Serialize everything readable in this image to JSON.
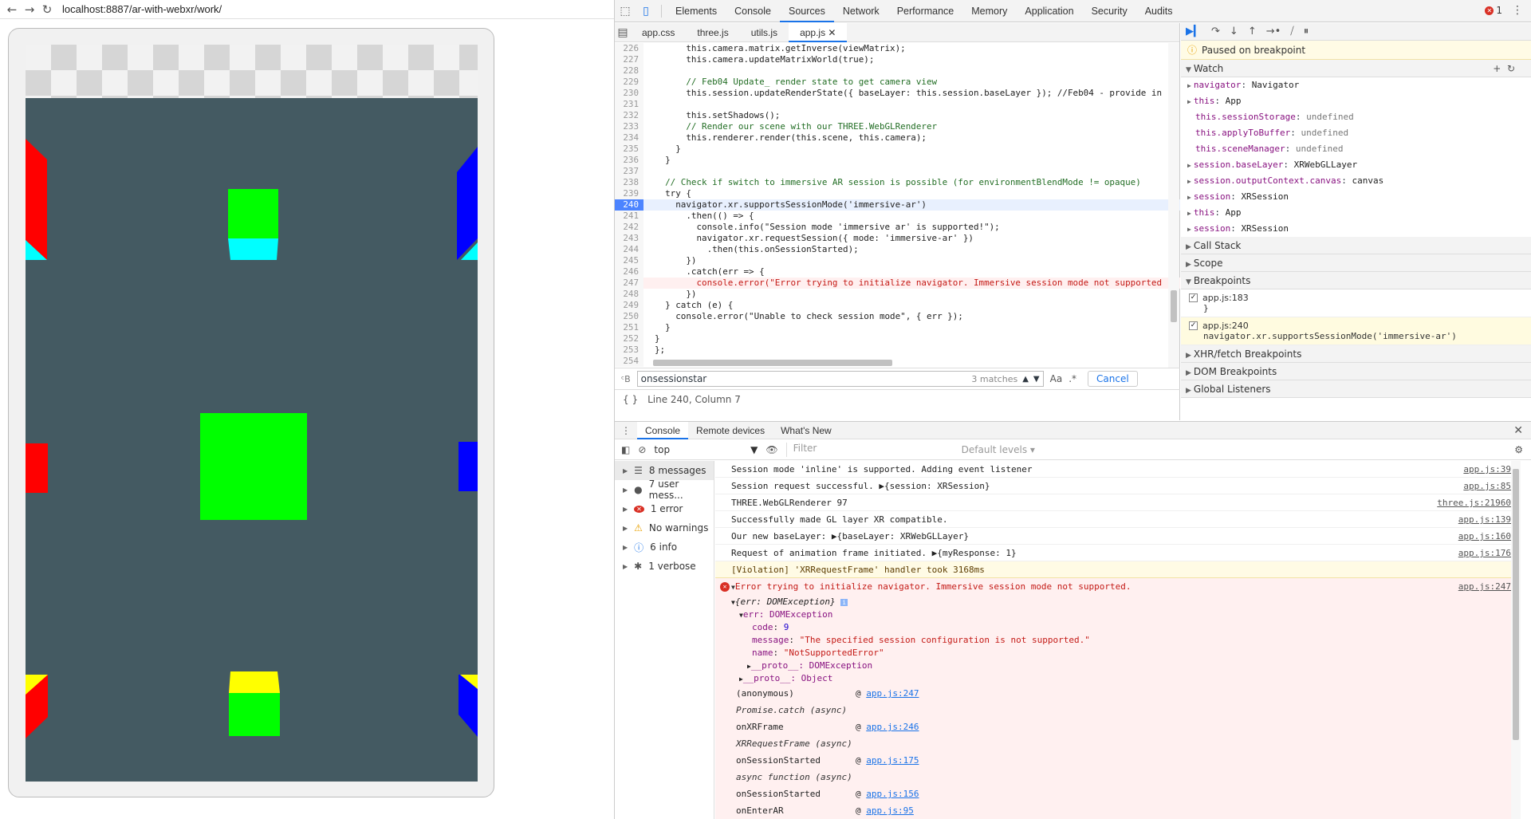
{
  "browser": {
    "url": "localhost:8887/ar-with-webxr/work/"
  },
  "colors": {
    "scene_bg": "#445a62",
    "green": "#00ff00",
    "cyan": "#00ffff",
    "red": "#ff0000",
    "blue": "#0000ff",
    "yellow": "#ffff00",
    "accent": "#1a73e8"
  },
  "devtools": {
    "tabs": [
      "Elements",
      "Console",
      "Sources",
      "Network",
      "Performance",
      "Memory",
      "Application",
      "Security",
      "Audits"
    ],
    "active_tab": "Sources",
    "error_count": "1",
    "file_tabs": [
      "app.css",
      "three.js",
      "utils.js",
      "app.js"
    ],
    "code_lines": [
      {
        "n": "226",
        "t": "      this.camera.matrix.getInverse(viewMatrix);"
      },
      {
        "n": "227",
        "t": "      this.camera.updateMatrixWorld(true);"
      },
      {
        "n": "228",
        "t": ""
      },
      {
        "n": "229",
        "t": "      // Feb04 Update_ render state to get camera view"
      },
      {
        "n": "230",
        "t": "      this.session.updateRenderState({ baseLayer: this.session.baseLayer }); //Feb04 - provide in"
      },
      {
        "n": "231",
        "t": ""
      },
      {
        "n": "232",
        "t": "      this.setShadows();"
      },
      {
        "n": "233",
        "t": "      // Render our scene with our THREE.WebGLRenderer"
      },
      {
        "n": "234",
        "t": "      this.renderer.render(this.scene, this.camera);"
      },
      {
        "n": "235",
        "t": "    }"
      },
      {
        "n": "236",
        "t": "  }"
      },
      {
        "n": "237",
        "t": ""
      },
      {
        "n": "238",
        "t": "  // Check if switch to immersive AR session is possible (for environmentBlendMode != opaque)"
      },
      {
        "n": "239",
        "t": "  try {"
      },
      {
        "n": "240",
        "t": "    navigator.xr.supportsSessionMode('immersive-ar')"
      },
      {
        "n": "241",
        "t": "      .then(() => {"
      },
      {
        "n": "242",
        "t": "        console.info(\"Session mode 'immersive ar' is supported!\");"
      },
      {
        "n": "243",
        "t": "        navigator.xr.requestSession({ mode: 'immersive-ar' })"
      },
      {
        "n": "244",
        "t": "          .then(this.onSessionStarted);"
      },
      {
        "n": "245",
        "t": "      })"
      },
      {
        "n": "246",
        "t": "      .catch(err => {"
      },
      {
        "n": "247",
        "t": "        console.error(\"Error trying to initialize navigator. Immersive session mode not supported"
      },
      {
        "n": "248",
        "t": "      })"
      },
      {
        "n": "249",
        "t": "  } catch (e) {"
      },
      {
        "n": "250",
        "t": "    console.error(\"Unable to check session mode\", { err });"
      },
      {
        "n": "251",
        "t": "  }"
      },
      {
        "n": "252",
        "t": "}"
      },
      {
        "n": "253",
        "t": "};"
      },
      {
        "n": "254",
        "t": ""
      }
    ],
    "search": {
      "value": "onsessionstar",
      "matches": "3 matches",
      "cancel": "Cancel"
    },
    "status": "Line 240, Column 7",
    "paused": "Paused on breakpoint",
    "sections": {
      "watch": "Watch",
      "call_stack": "Call Stack",
      "scope": "Scope",
      "breakpoints": "Breakpoints",
      "xhr": "XHR/fetch Breakpoints",
      "dom": "DOM Breakpoints",
      "global": "Global Listeners"
    },
    "watch": [
      {
        "k": "navigator",
        "v": "Navigator",
        "exp": true
      },
      {
        "k": "this",
        "v": "App",
        "exp": true
      },
      {
        "k": "this.sessionStorage",
        "v": "undefined",
        "exp": false
      },
      {
        "k": "this.applyToBuffer",
        "v": "undefined",
        "exp": false
      },
      {
        "k": "this.sceneManager",
        "v": "undefined",
        "exp": false
      },
      {
        "k": "session.baseLayer",
        "v": "XRWebGLLayer",
        "exp": true
      },
      {
        "k": "session.outputContext.canvas",
        "v": "canvas",
        "exp": true
      },
      {
        "k": "session",
        "v": "XRSession",
        "exp": true
      },
      {
        "k": "this",
        "v": "App",
        "exp": true
      },
      {
        "k": "session",
        "v": "XRSession",
        "exp": true
      }
    ],
    "breakpoints": [
      {
        "file": "app.js:183",
        "src": "}"
      },
      {
        "file": "app.js:240",
        "src": "navigator.xr.supportsSessionMode('immersive-ar')"
      }
    ]
  },
  "console": {
    "drawer_tabs": [
      "Console",
      "Remote devices",
      "What's New"
    ],
    "context": "top",
    "filter_placeholder": "Filter",
    "levels": "Default levels",
    "sidebar": [
      {
        "label": "8 messages",
        "icon": "list"
      },
      {
        "label": "7 user mess...",
        "icon": "user"
      },
      {
        "label": "1 error",
        "icon": "error"
      },
      {
        "label": "No warnings",
        "icon": "warning"
      },
      {
        "label": "6 info",
        "icon": "info"
      },
      {
        "label": "1 verbose",
        "icon": "verbose"
      }
    ],
    "messages": [
      {
        "text": "Session mode 'inline' is supported. Adding event listener",
        "loc": "app.js:39"
      },
      {
        "text": "Session request successful. ▶{session: XRSession}",
        "loc": "app.js:85"
      },
      {
        "text": "THREE.WebGLRenderer 97",
        "loc": "three.js:21960"
      },
      {
        "text": "Successfully made GL layer XR compatible.",
        "loc": "app.js:139"
      },
      {
        "text": "Our new baseLayer: ▶{baseLayer: XRWebGLLayer}",
        "loc": "app.js:160"
      },
      {
        "text": "Request of animation frame initiated. ▶{myResponse: 1}",
        "loc": "app.js:176"
      }
    ],
    "violation": "[Violation] 'XRRequestFrame' handler took 3168ms",
    "error": {
      "title": "Error trying to initialize navigator. Immersive session mode not supported.",
      "loc": "app.js:247",
      "obj": "{err: DOMException}",
      "err_label": "err: DOMException",
      "code": "9",
      "message": "\"The specified session configuration is not supported.\"",
      "name": "\"NotSupportedError\"",
      "proto1": "__proto__: DOMException",
      "proto2": "__proto__: Object"
    },
    "stack": [
      {
        "fn": "(anonymous)",
        "loc": "app.js:247",
        "async": false
      },
      {
        "fn": "Promise.catch (async)",
        "loc": "",
        "async": true
      },
      {
        "fn": "onXRFrame",
        "loc": "app.js:246",
        "async": false
      },
      {
        "fn": "XRRequestFrame (async)",
        "loc": "",
        "async": true
      },
      {
        "fn": "onSessionStarted",
        "loc": "app.js:175",
        "async": false
      },
      {
        "fn": "async function (async)",
        "loc": "",
        "async": true
      },
      {
        "fn": "onSessionStarted",
        "loc": "app.js:156",
        "async": false
      },
      {
        "fn": "onEnterAR",
        "loc": "app.js:95",
        "async": false
      }
    ]
  }
}
